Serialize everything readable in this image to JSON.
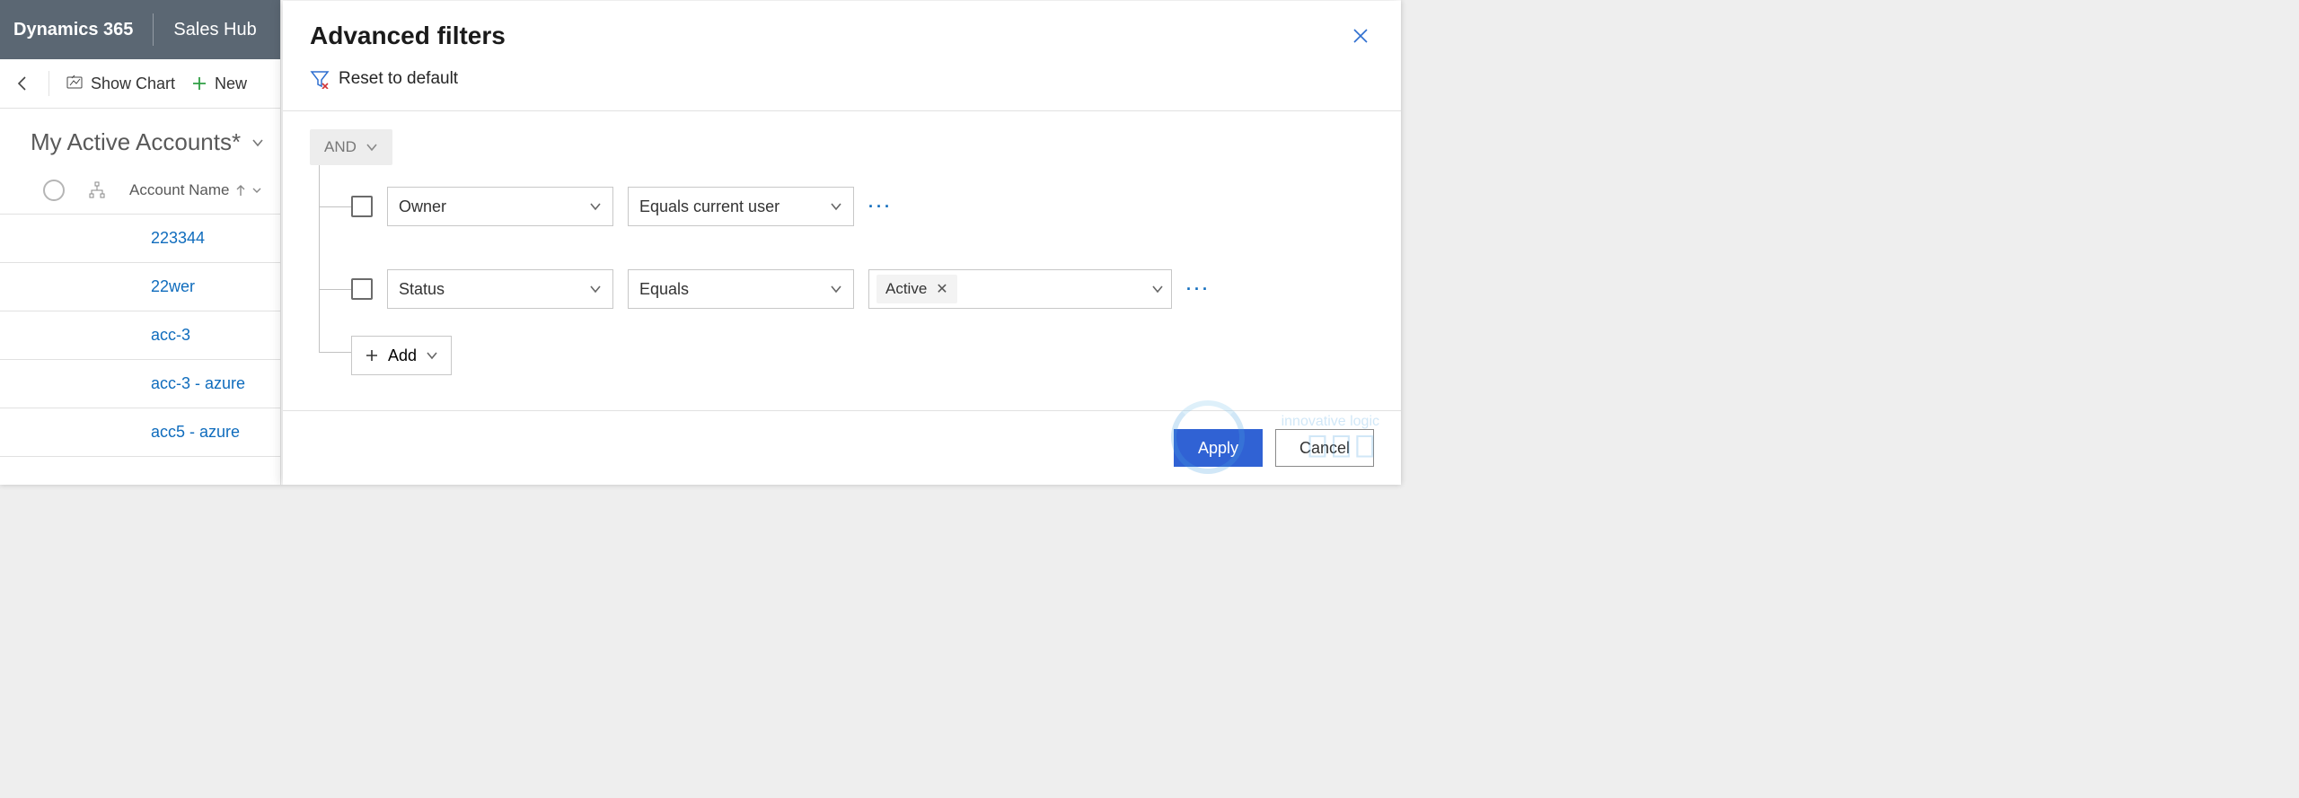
{
  "brand": {
    "product": "Dynamics 365",
    "app": "Sales Hub"
  },
  "toolbar": {
    "show_chart": "Show Chart",
    "new": "New"
  },
  "view": {
    "title": "My Active Accounts*"
  },
  "grid": {
    "column": "Account Name",
    "rows": [
      "223344",
      "22wer",
      "acc-3",
      "acc-3 - azure",
      "acc5 - azure"
    ]
  },
  "panel": {
    "title": "Advanced filters",
    "reset": "Reset to default",
    "operator": "AND",
    "rows": [
      {
        "field": "Owner",
        "op": "Equals current user",
        "value": null
      },
      {
        "field": "Status",
        "op": "Equals",
        "value": "Active"
      }
    ],
    "add": "Add",
    "apply": "Apply",
    "cancel": "Cancel"
  },
  "watermark": "innovative logic"
}
